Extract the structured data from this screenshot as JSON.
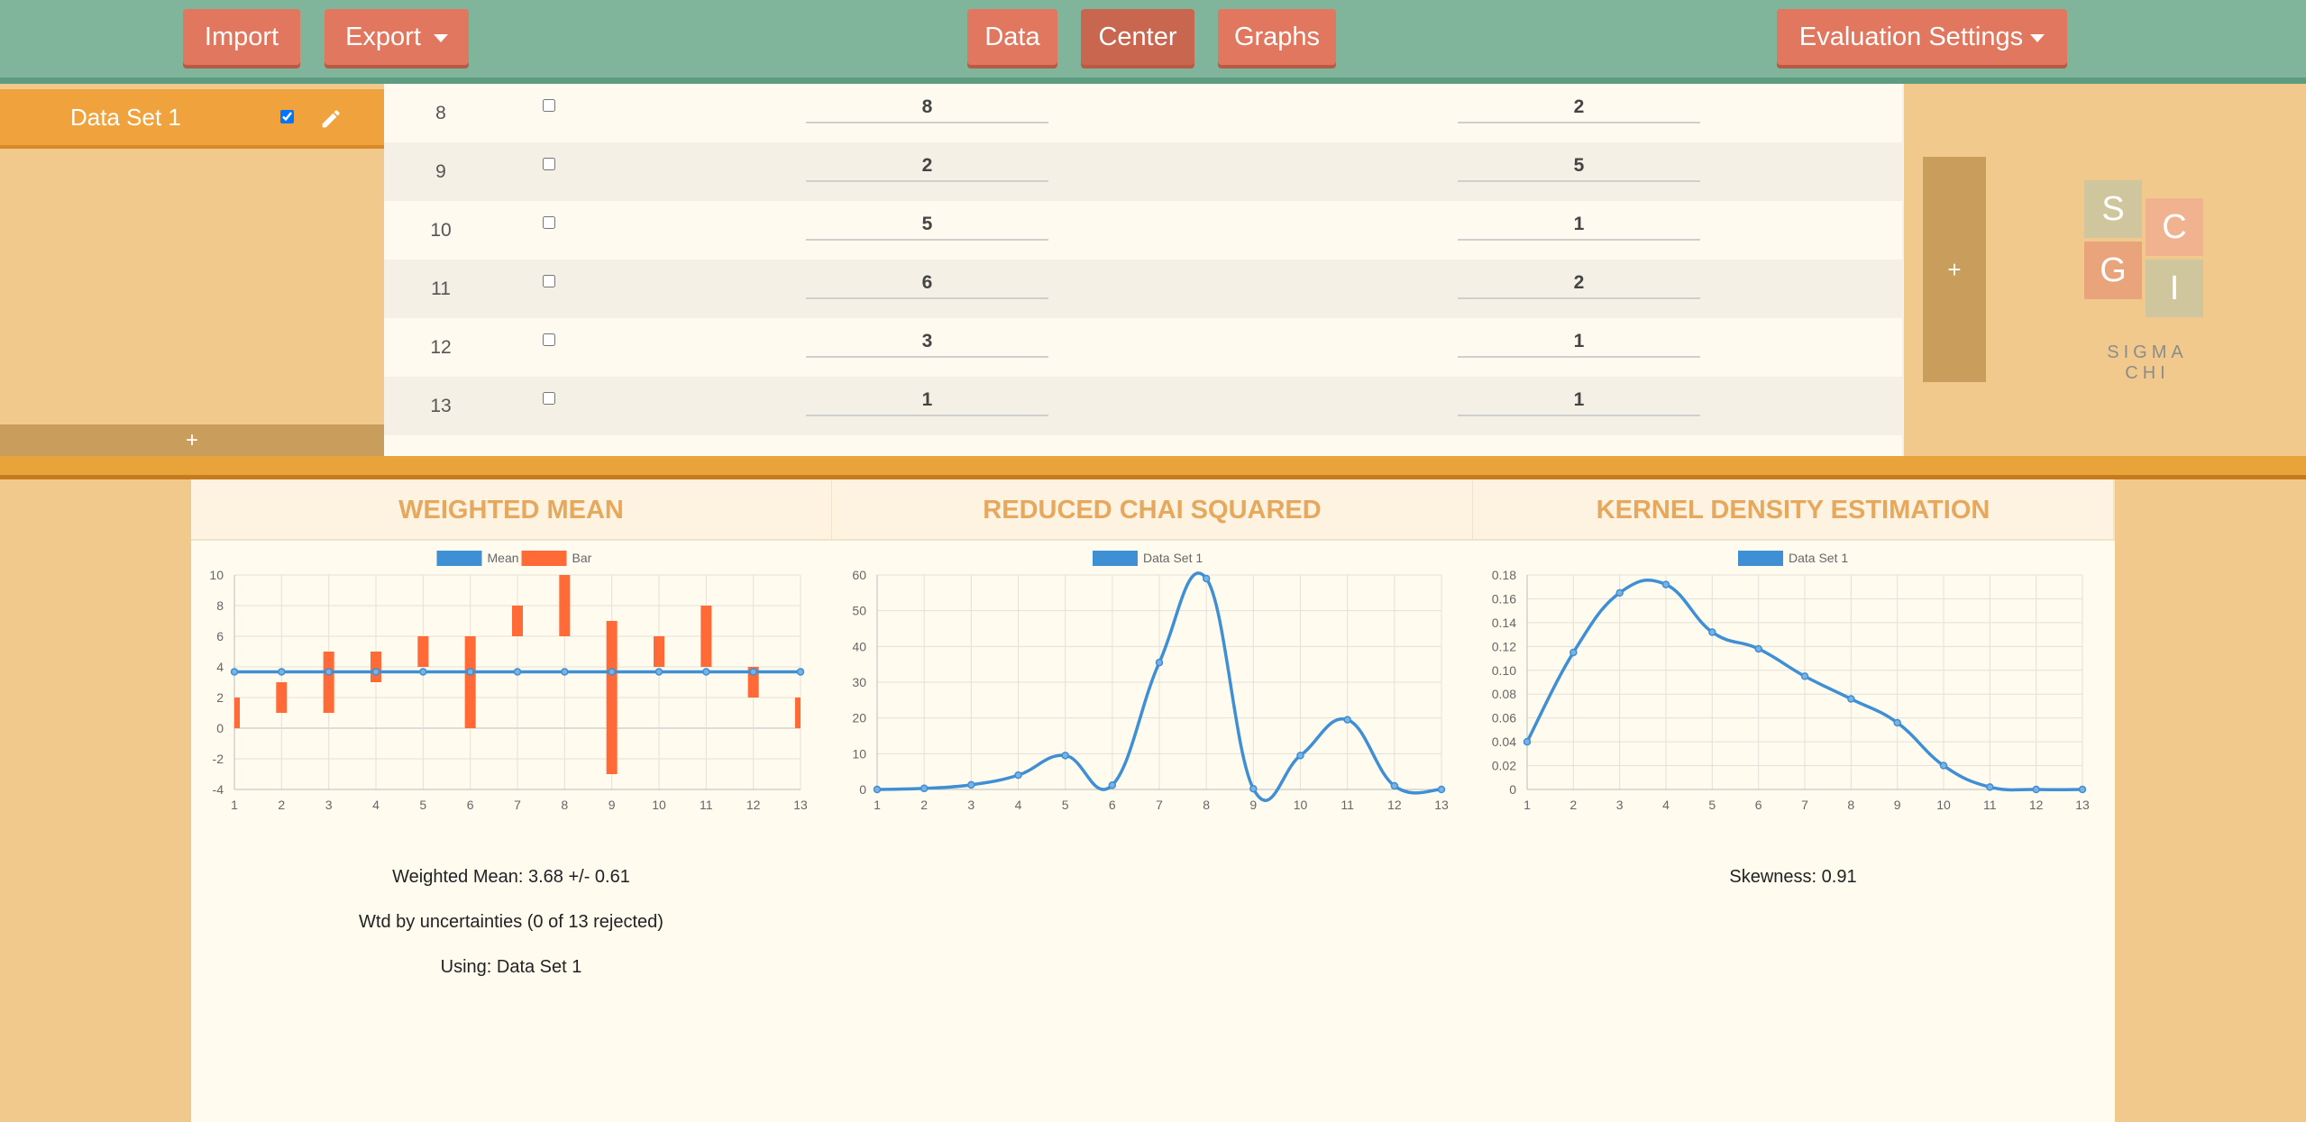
{
  "toolbar": {
    "import_label": "Import",
    "export_label": "Export",
    "data_label": "Data",
    "center_label": "Center",
    "graphs_label": "Graphs",
    "eval_label": "Evaluation Settings"
  },
  "sidebar": {
    "datasets": [
      {
        "label": "Data Set 1",
        "checked": true
      }
    ],
    "add_label": "+"
  },
  "table": {
    "rows": [
      {
        "index": "8",
        "checked": false,
        "value": "8",
        "uncertainty": "2"
      },
      {
        "index": "9",
        "checked": false,
        "value": "2",
        "uncertainty": "5"
      },
      {
        "index": "10",
        "checked": false,
        "value": "5",
        "uncertainty": "1"
      },
      {
        "index": "11",
        "checked": false,
        "value": "6",
        "uncertainty": "2"
      },
      {
        "index": "12",
        "checked": false,
        "value": "3",
        "uncertainty": "1"
      },
      {
        "index": "13",
        "checked": false,
        "value": "1",
        "uncertainty": "1"
      }
    ],
    "add_column_label": "+"
  },
  "logo": {
    "letters": [
      "S",
      "C",
      "G",
      "I"
    ],
    "text": "SIGMA CHI",
    "colors": [
      "#cfc69e",
      "#f0b28f",
      "#e9a47c",
      "#cfc69e"
    ]
  },
  "panels": {
    "weighted_mean": {
      "title": "Weighted Mean",
      "result": "Weighted Mean: 3.68 +/- 0.61",
      "note": "Wtd by uncertainties (0 of 13 rejected)",
      "using": "Using: Data Set 1"
    },
    "chi_squared": {
      "title": "Reduced Chai Squared"
    },
    "kde": {
      "title": "Kernel Density Estimation",
      "result": "Skewness: 0.91"
    }
  },
  "colors": {
    "line": "#3e8fd4",
    "bar": "#ff6a37",
    "grid": "#e4e1d8",
    "axis_text": "#666666"
  },
  "chart_data": [
    {
      "type": "bar",
      "legend": [
        "Mean",
        "Bar"
      ],
      "legend_position": "top",
      "categories": [
        "1",
        "2",
        "3",
        "4",
        "5",
        "6",
        "7",
        "8",
        "9",
        "10",
        "11",
        "12",
        "13"
      ],
      "series": [
        {
          "name": "Mean",
          "type": "line",
          "values": [
            3.68,
            3.68,
            3.68,
            3.68,
            3.68,
            3.68,
            3.68,
            3.68,
            3.68,
            3.68,
            3.68,
            3.68,
            3.68
          ]
        },
        {
          "name": "Bar",
          "type": "floating-bar",
          "low": [
            0,
            1,
            1,
            3,
            4,
            0,
            6,
            6,
            -3,
            4,
            4,
            2,
            0
          ],
          "high": [
            2,
            3,
            5,
            5,
            6,
            6,
            8,
            10,
            7,
            6,
            8,
            4,
            2
          ]
        }
      ],
      "ylim": [
        -4,
        10
      ],
      "yticks": [
        -4,
        -2,
        0,
        2,
        4,
        6,
        8,
        10
      ],
      "grid": true
    },
    {
      "type": "line",
      "legend": [
        "Data Set 1"
      ],
      "legend_position": "top",
      "categories": [
        "1",
        "2",
        "3",
        "4",
        "5",
        "6",
        "7",
        "8",
        "9",
        "10",
        "11",
        "12",
        "13"
      ],
      "series": [
        {
          "name": "Data Set 1",
          "values": [
            0,
            0.3,
            1.3,
            4,
            9.5,
            1.2,
            35.5,
            59,
            0.2,
            9.5,
            19.5,
            1,
            0
          ]
        }
      ],
      "ylim": [
        0,
        60
      ],
      "yticks": [
        0,
        10,
        20,
        30,
        40,
        50,
        60
      ],
      "grid": true
    },
    {
      "type": "line",
      "legend": [
        "Data Set 1"
      ],
      "legend_position": "top",
      "categories": [
        "1",
        "2",
        "3",
        "4",
        "5",
        "6",
        "7",
        "8",
        "9",
        "10",
        "11",
        "12",
        "13"
      ],
      "series": [
        {
          "name": "Data Set 1",
          "values": [
            0.04,
            0.115,
            0.165,
            0.172,
            0.132,
            0.118,
            0.095,
            0.076,
            0.056,
            0.02,
            0.002,
            0.0,
            0.0
          ]
        }
      ],
      "ylim": [
        0,
        0.18
      ],
      "yticks": [
        "0",
        "0.02",
        "0.04",
        "0.06",
        "0.08",
        "0.10",
        "0.12",
        "0.14",
        "0.16",
        "0.18"
      ],
      "grid": true
    }
  ]
}
